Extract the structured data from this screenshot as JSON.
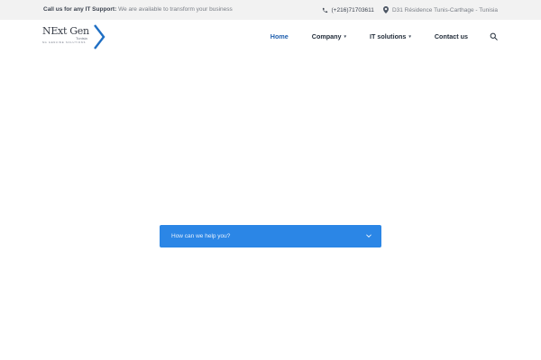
{
  "topbar": {
    "support_label": "Call us for any IT Support:",
    "support_text": "We are available to transform your business",
    "phone": "(+216)71703611",
    "address": "D31 Résidence Tunis-Carthage - Tunisia"
  },
  "logo": {
    "brand": "NExt Gen",
    "sub1": "Tunisia",
    "sub2": "NG GENUINE SOLUTIONS"
  },
  "nav": {
    "items": [
      {
        "label": "Home",
        "active": true
      },
      {
        "label": "Company",
        "dropdown": true
      },
      {
        "label": "IT solutions",
        "dropdown": true
      },
      {
        "label": "Contact us"
      }
    ]
  },
  "help": {
    "label": "How can we help you?"
  },
  "colors": {
    "accent": "#2b86e6",
    "nav_active": "#1f5fae",
    "topbar_bg": "#f2f2f2"
  }
}
